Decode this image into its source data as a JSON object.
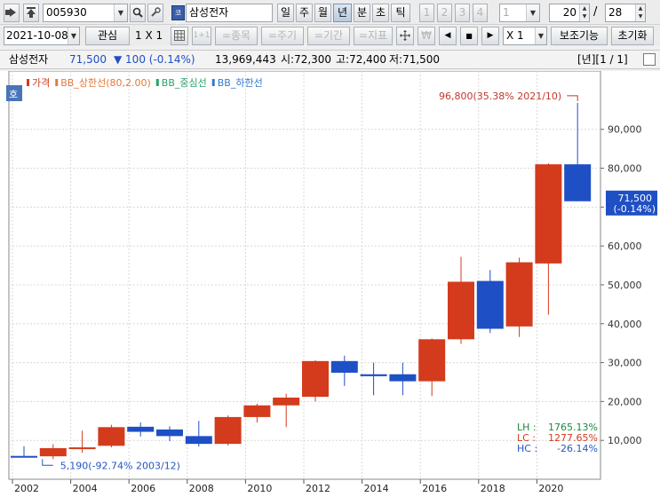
{
  "toolbar": {
    "stock_code": "005930",
    "code_tag": "코드",
    "stock_name": "삼성전자",
    "periods": [
      "일",
      "주",
      "월",
      "년",
      "분",
      "초",
      "틱"
    ],
    "active_period": "년",
    "interval_buttons": [
      "1",
      "2",
      "3",
      "4"
    ],
    "interval_value": "1",
    "view_count": "20",
    "view_separator": "/",
    "total_count": "28",
    "date": "2021-10-08",
    "interest_label": "관심",
    "layout_label": "1 X 1",
    "layout_small": "1+1",
    "item_btn": "=종목",
    "period_btn": "=주기",
    "range_btn": "=기간",
    "indicator_btn": "=지표",
    "currency_sym": "₩",
    "zoom_value": "X 1",
    "aux_btn": "보조기능",
    "reset_btn": "초기화"
  },
  "infobar": {
    "name": "삼성전자",
    "price": "71,500",
    "change": "▼ 100 (-0.14%)",
    "volume": "13,969,443",
    "open": "시:72,300",
    "high": "고:72,400",
    "low": "저:71,500",
    "page": "[년][1 / 1]"
  },
  "legend": {
    "badge": "호",
    "items": [
      {
        "label": "가격",
        "color": "#d33b1c"
      },
      {
        "label": "BB_상한선(80,2.00)",
        "color": "#e07a3c"
      },
      {
        "label": "BB_중심선",
        "color": "#28a36a"
      },
      {
        "label": "BB_하한선",
        "color": "#3478d0"
      }
    ]
  },
  "annotations": {
    "max": "96,800(35.38% 2021/10)",
    "min": "5,190(-92.74% 2003/12)"
  },
  "stats": [
    {
      "label": "LH :",
      "value": "1765.13%",
      "color": "#1a8a3e"
    },
    {
      "label": "LC :",
      "value": "1277.65%",
      "color": "#d33b1c"
    },
    {
      "label": "HC :",
      "value": "-26.14%",
      "color": "#2457c5"
    }
  ],
  "current_label": {
    "price": "71,500",
    "change": "(-0.14%)"
  },
  "colors": {
    "up": "#d33b1c",
    "down": "#1f4fc4",
    "grid": "#d8d8d8"
  },
  "chart_data": {
    "type": "candlestick",
    "x_tick_labels": [
      "2002",
      "2004",
      "2006",
      "2008",
      "2010",
      "2012",
      "2014",
      "2016",
      "2018",
      "2020"
    ],
    "y_tick_labels": [
      "10,000",
      "20,000",
      "30,000",
      "40,000",
      "50,000",
      "60,000",
      "70,000",
      "80,000",
      "90,000"
    ],
    "ylim": [
      0,
      105000
    ],
    "grid": true,
    "candles": [
      {
        "year": 2002,
        "open": 6000,
        "close": 5900,
        "high": 8500,
        "low": 5600
      },
      {
        "year": 2003,
        "open": 5900,
        "close": 8000,
        "high": 9000,
        "low": 5190
      },
      {
        "year": 2004,
        "open": 8000,
        "close": 8200,
        "high": 12500,
        "low": 6800
      },
      {
        "year": 2005,
        "open": 8600,
        "close": 13400,
        "high": 14000,
        "low": 8200
      },
      {
        "year": 2006,
        "open": 13500,
        "close": 12200,
        "high": 14600,
        "low": 11000
      },
      {
        "year": 2007,
        "open": 12800,
        "close": 11100,
        "high": 13600,
        "low": 9800
      },
      {
        "year": 2008,
        "open": 11100,
        "close": 9100,
        "high": 15000,
        "low": 8400
      },
      {
        "year": 2009,
        "open": 9100,
        "close": 16000,
        "high": 16400,
        "low": 8700
      },
      {
        "year": 2010,
        "open": 16000,
        "close": 19000,
        "high": 19400,
        "low": 14600
      },
      {
        "year": 2011,
        "open": 19000,
        "close": 21000,
        "high": 22000,
        "low": 13400
      },
      {
        "year": 2012,
        "open": 21200,
        "close": 30400,
        "high": 30600,
        "low": 20000
      },
      {
        "year": 2013,
        "open": 30400,
        "close": 27400,
        "high": 31800,
        "low": 24000
      },
      {
        "year": 2014,
        "open": 27000,
        "close": 26500,
        "high": 30000,
        "low": 21600
      },
      {
        "year": 2015,
        "open": 27000,
        "close": 25200,
        "high": 30000,
        "low": 21600
      },
      {
        "year": 2016,
        "open": 25200,
        "close": 36000,
        "high": 36200,
        "low": 21400
      },
      {
        "year": 2017,
        "open": 36000,
        "close": 50800,
        "high": 57200,
        "low": 34800
      },
      {
        "year": 2018,
        "open": 51000,
        "close": 38700,
        "high": 53800,
        "low": 37600
      },
      {
        "year": 2019,
        "open": 39300,
        "close": 55800,
        "high": 57000,
        "low": 36600
      },
      {
        "year": 2020,
        "open": 55500,
        "close": 81000,
        "high": 81300,
        "low": 42300
      },
      {
        "year": 2021,
        "open": 81000,
        "close": 71500,
        "high": 96800,
        "low": 71500
      }
    ]
  }
}
